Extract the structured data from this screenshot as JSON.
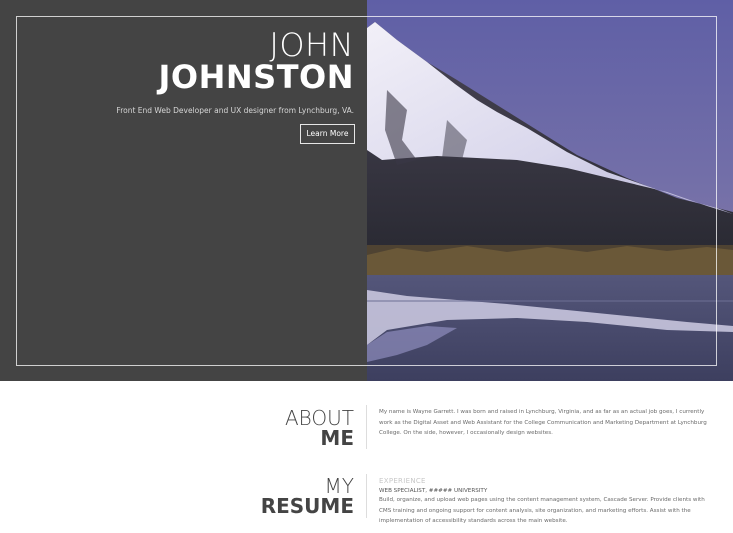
{
  "hero": {
    "first_name": "JOHN",
    "last_name": "JOHNSTON",
    "tagline": "Front End Web Developer and UX designer from Lynchburg, VA.",
    "button_label": "Learn More"
  },
  "about": {
    "title_light": "ABOUT",
    "title_bold": "ME",
    "text": "My name is Wayne Garrett. I was born and raised in Lynchburg, Virginia, and as far as an actual job goes, I currently work as the Digital Asset and Web Assistant for the College Communication and Marketing Department at Lynchburg College. On the side, however, I occasionally design websites."
  },
  "resume": {
    "title_light": "MY",
    "title_bold": "RESUME",
    "experience_label": "EXPERIENCE",
    "job_title": "WEB SPECIALIST, ##### UNIVERSITY",
    "job_text": "Build, organize, and upload web pages using the content management system, Cascade Server. Provide clients with CMS training and ongoing support for content analysis, site organization, and marketing efforts. Assist with the implementation of accessibility standards across the main website."
  },
  "colors": {
    "hero_panel": "#444444",
    "sky": "#6e6aa8",
    "heading_text": "#444444"
  }
}
